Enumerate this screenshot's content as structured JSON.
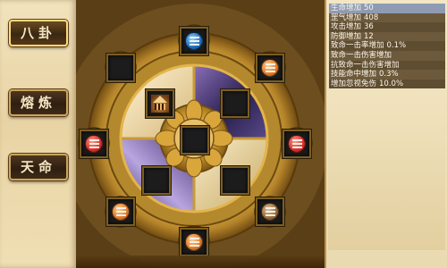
{
  "tabs": [
    {
      "label": "八卦"
    },
    {
      "label": "熔炼"
    },
    {
      "label": "天命"
    }
  ],
  "colors": {
    "gold": "#c99a35",
    "dark_gold": "#7a5618",
    "parchment": "#f3e6c4",
    "stat_row": "#6d5a3c",
    "highlight": "#8e9bb3"
  },
  "wheel": {
    "quadrants": [
      "light-gold",
      "purple-night",
      "purple-swirl",
      "light-cream"
    ],
    "outer_slots": [
      {
        "name": "top",
        "gem": "blue",
        "icon": "trigram-icon"
      },
      {
        "name": "top-right",
        "gem": "orange",
        "icon": "trigram-icon"
      },
      {
        "name": "right",
        "gem": "red",
        "icon": "trigram-icon"
      },
      {
        "name": "bottom-right",
        "gem": "brown",
        "icon": "trigram-icon"
      },
      {
        "name": "bottom",
        "gem": "orange",
        "icon": "trigram-icon"
      },
      {
        "name": "bottom-left",
        "gem": "orange",
        "icon": "trigram-icon"
      },
      {
        "name": "left",
        "gem": "red",
        "icon": "trigram-icon"
      },
      {
        "name": "top-left",
        "gem": "empty",
        "icon": ""
      }
    ],
    "inner_slots": [
      {
        "name": "inner-top-left",
        "content": "temple-icon"
      },
      {
        "name": "inner-top-right",
        "content": "empty"
      },
      {
        "name": "inner-bottom-left",
        "content": "empty"
      },
      {
        "name": "inner-bottom-right",
        "content": "empty"
      },
      {
        "name": "center",
        "content": "empty"
      }
    ]
  },
  "stats": [
    {
      "label": "生命增加",
      "value": "50"
    },
    {
      "label": "罡气增加",
      "value": "408"
    },
    {
      "label": "攻击增加",
      "value": "36"
    },
    {
      "label": "防御增加",
      "value": "12"
    },
    {
      "label": "致命一击率增加",
      "value": "0.1%"
    },
    {
      "label": "致命一击伤害增加",
      "value": ""
    },
    {
      "label": "抗致命一击伤害增加",
      "value": ""
    },
    {
      "label": "技能命中增加",
      "value": "0.3%"
    },
    {
      "label": "增加忽视免伤",
      "value": "10.0%"
    }
  ]
}
